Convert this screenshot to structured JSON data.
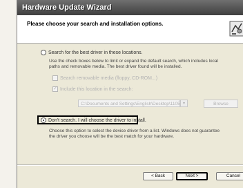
{
  "window": {
    "title": "Hardware Update Wizard"
  },
  "header": {
    "title": "Please choose your search and installation options.",
    "icon": "wizard-hardware-icon"
  },
  "options": {
    "search": {
      "label": "Search for the best driver in these locations.",
      "description_1": "Use the check boxes below to limit or expand the default search, which includes local",
      "description_2": "paths and removable media. The best driver found will be installed.",
      "selected": false
    },
    "removable_media": {
      "label": "Search removable media (floppy, CD-ROM...)",
      "checked": false,
      "enabled": false
    },
    "include_location": {
      "label": "Include this location in the search:",
      "checked": true,
      "enabled": false
    },
    "path": {
      "value": "C:\\Documents and Settings\\English\\Desktop\\11053"
    },
    "browse_label": "Browse",
    "dont_search": {
      "label": "Don't search. I will choose the driver to install.",
      "description_1": "Choose this option to select the device driver from a list.  Windows does not guarantee",
      "description_2": "the driver you choose will be the best match for your hardware.",
      "selected": true
    }
  },
  "buttons": {
    "back": "< Back",
    "next": "Next >",
    "cancel": "Cancel"
  }
}
